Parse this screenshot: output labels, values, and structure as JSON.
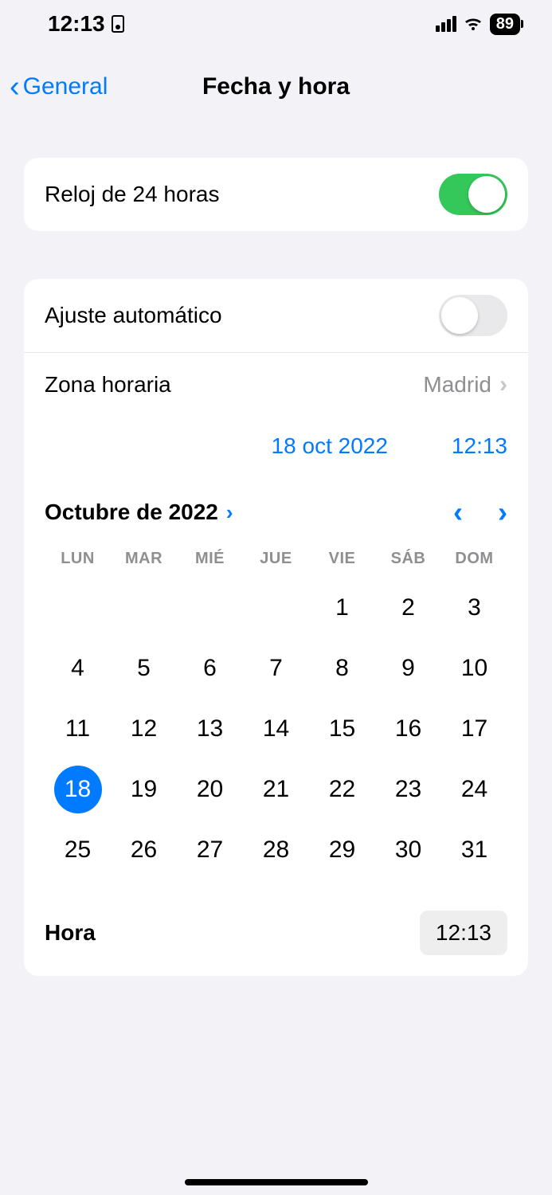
{
  "status": {
    "time": "12:13",
    "battery": "89"
  },
  "nav": {
    "back": "General",
    "title": "Fecha y hora"
  },
  "clock24": {
    "label": "Reloj de 24 horas",
    "on": true
  },
  "autoset": {
    "label": "Ajuste automático",
    "on": false
  },
  "timezone": {
    "label": "Zona horaria",
    "value": "Madrid"
  },
  "datetime": {
    "date_btn": "18 oct 2022",
    "time_btn": "12:13"
  },
  "calendar": {
    "title": "Octubre de 2022",
    "dow": [
      "LUN",
      "MAR",
      "MIÉ",
      "JUE",
      "VIE",
      "SÁB",
      "DOM"
    ],
    "leading_blanks": 4,
    "days": 31,
    "selected": 18
  },
  "hora": {
    "label": "Hora",
    "value": "12:13"
  }
}
